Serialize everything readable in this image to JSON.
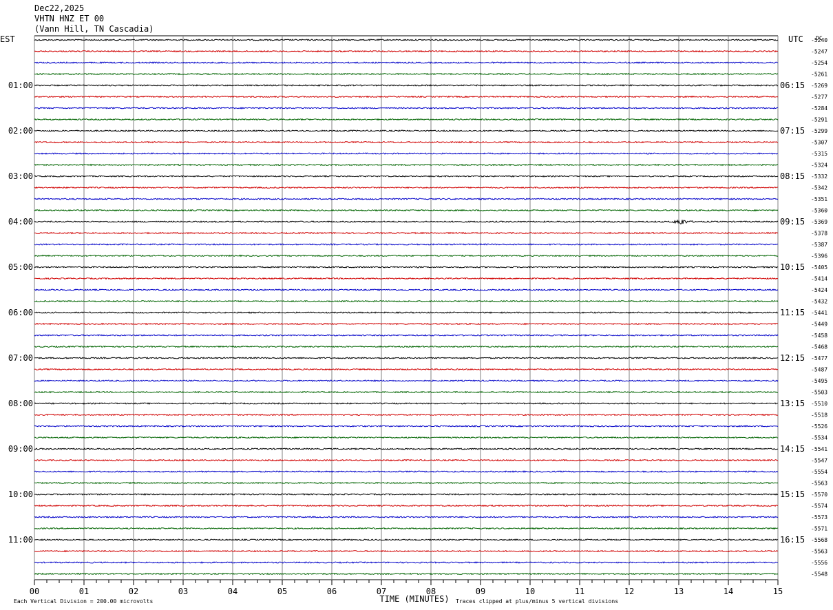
{
  "header": {
    "date": "Dec22,2025",
    "station": "VHTN HNZ ET 00",
    "location": "(Vann Hill, TN Cascadia)"
  },
  "labels": {
    "left_timezone": "EST",
    "right_timezone": "UTC",
    "dc_label": "DC",
    "xlabel": "TIME (MINUTES)",
    "footer_left": "Each Vertical Division =  200.00 microvolts",
    "footer_right": "Traces clipped at plus/minus 5 vertical divisions"
  },
  "colors": {
    "trace_cycle": [
      "#000000",
      "#d00000",
      "#0000c8",
      "#006400"
    ],
    "grid": "#808080"
  },
  "chart_data": {
    "type": "line",
    "title": "VHTN HNZ ET 00",
    "xlabel": "TIME (MINUTES)",
    "xlim": [
      0,
      15
    ],
    "x_ticks": [
      "00",
      "01",
      "02",
      "03",
      "04",
      "05",
      "06",
      "07",
      "08",
      "09",
      "10",
      "11",
      "12",
      "13",
      "14",
      "15"
    ],
    "left_hour_labels": [
      "01:00",
      "02:00",
      "03:00",
      "04:00",
      "05:00",
      "06:00",
      "07:00",
      "08:00",
      "09:00",
      "10:00",
      "11:00"
    ],
    "right_hour_labels": [
      "06:15",
      "07:15",
      "08:15",
      "09:15",
      "10:15",
      "11:15",
      "12:15",
      "13:15",
      "14:15",
      "15:15",
      "16:15"
    ],
    "dc_offsets": [
      "-5240",
      "-5247",
      "-5254",
      "-5261",
      "-5269",
      "-5277",
      "-5284",
      "-5291",
      "-5299",
      "-5307",
      "-5315",
      "-5324",
      "-5332",
      "-5342",
      "-5351",
      "-5360",
      "-5369",
      "-5378",
      "-5387",
      "-5396",
      "-5405",
      "-5414",
      "-5424",
      "-5432",
      "-5441",
      "-5449",
      "-5458",
      "-5468",
      "-5477",
      "-5487",
      "-5495",
      "-5503",
      "-5510",
      "-5518",
      "-5526",
      "-5534",
      "-5541",
      "-5547",
      "-5554",
      "-5563",
      "-5570",
      "-5574",
      "-5573",
      "-5571",
      "-5568",
      "-5563",
      "-5556",
      "-5548"
    ],
    "trace_count": 48,
    "trace_minutes": 15,
    "events": [
      {
        "trace_index": 16,
        "minute": 13.0
      }
    ],
    "grid": true
  }
}
